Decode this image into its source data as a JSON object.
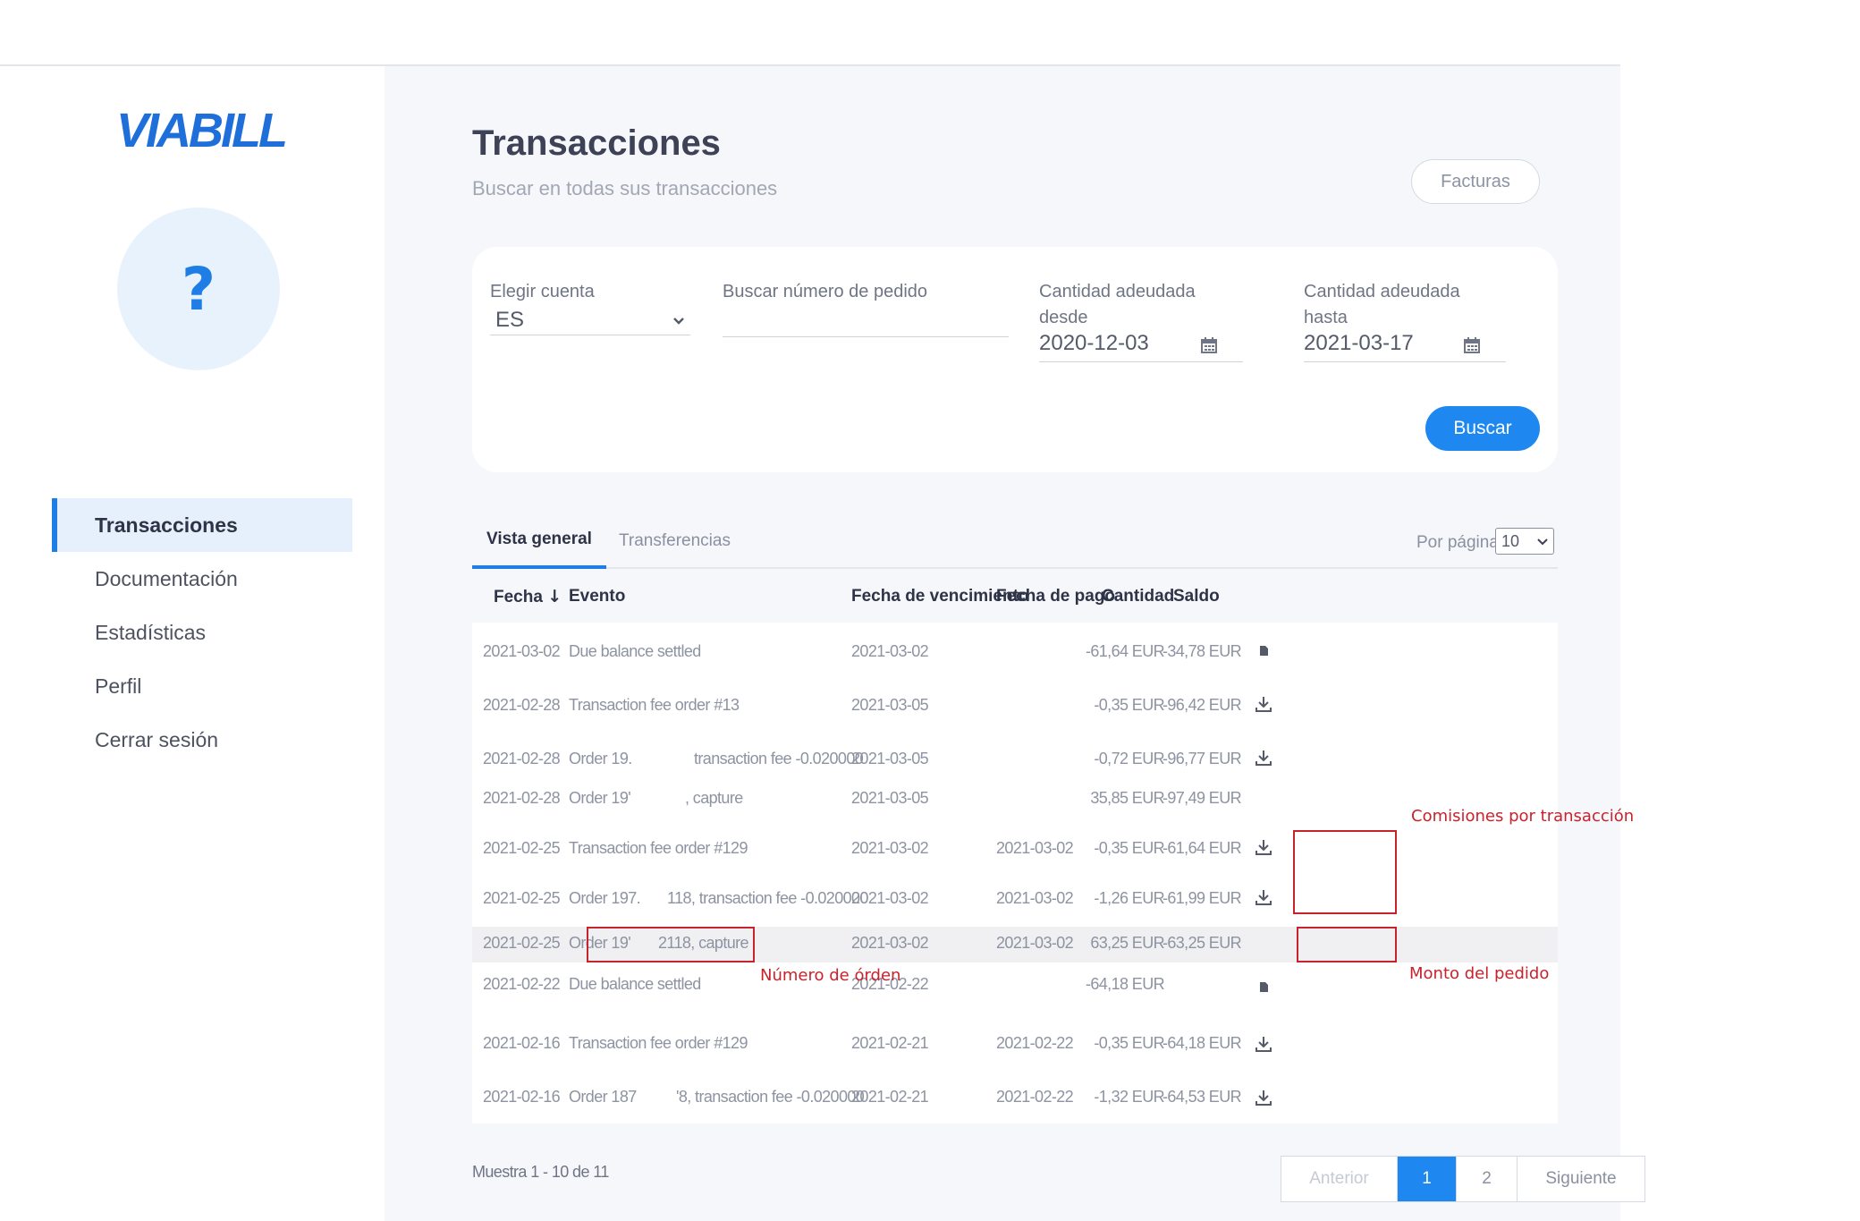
{
  "sidebar": {
    "logo_text": "VIABILL",
    "avatar_symbol": "?",
    "items": [
      {
        "label": "Transacciones",
        "active": true
      },
      {
        "label": "Documentación",
        "active": false
      },
      {
        "label": "Estadísticas",
        "active": false
      },
      {
        "label": "Perfil",
        "active": false
      },
      {
        "label": "Cerrar sesión",
        "active": false
      }
    ]
  },
  "header": {
    "title": "Transacciones",
    "subtitle": "Buscar en todas sus transacciones",
    "invoices_button": "Facturas"
  },
  "filters": {
    "account_label": "Elegir cuenta",
    "account_value": "ES",
    "order_label": "Buscar número de pedido",
    "order_value": "",
    "from_label_1": "Cantidad adeudada",
    "from_label_2": "desde",
    "from_value": "2020-12-03",
    "to_label_1": "Cantidad adeudada",
    "to_label_2": "hasta",
    "to_value": "2021-03-17",
    "search_button": "Buscar"
  },
  "tabs": {
    "overview": "Vista general",
    "transfers": "Transferencias",
    "per_page_label": "Por página",
    "per_page_value": "10"
  },
  "table": {
    "columns": {
      "date": "Fecha",
      "event": "Evento",
      "due_date": "Fecha de vencimiento",
      "pay_date": "Fecha de pago",
      "amount": "Cantidad",
      "balance": "Saldo"
    },
    "rows": [
      {
        "date": "2021-03-02",
        "event_a": "Due balance settled",
        "event_b": "",
        "due": "2021-03-02",
        "paid": "",
        "amount": "-61,64 EUR",
        "balance": "-34,78 EUR",
        "icon": "document-icon"
      },
      {
        "date": "2021-02-28",
        "event_a": "Transaction fee order #13",
        "event_b": "",
        "due": "2021-03-05",
        "paid": "",
        "amount": "-0,35 EUR",
        "balance": "-96,42 EUR",
        "icon": "download-icon"
      },
      {
        "date": "2021-02-28",
        "event_a": "Order 19.",
        "event_b": "transaction fee -0.020000",
        "due": "2021-03-05",
        "paid": "",
        "amount": "-0,72 EUR",
        "balance": "-96,77 EUR",
        "icon": "download-icon"
      },
      {
        "date": "2021-02-28",
        "event_a": "Order 19'",
        "event_b": ", capture",
        "due": "2021-03-05",
        "paid": "",
        "amount": "35,85 EUR",
        "balance": "-97,49 EUR",
        "icon": ""
      },
      {
        "date": "2021-02-25",
        "event_a": "Transaction fee order #129",
        "event_b": "",
        "due": "2021-03-02",
        "paid": "2021-03-02",
        "amount": "-0,35 EUR",
        "balance": "-61,64 EUR",
        "icon": "download-icon"
      },
      {
        "date": "2021-02-25",
        "event_a": "Order 197.",
        "event_b": "118, transaction fee -0.020000",
        "due": "2021-03-02",
        "paid": "2021-03-02",
        "amount": "-1,26 EUR",
        "balance": "-61,99 EUR",
        "icon": "download-icon"
      },
      {
        "date": "2021-02-25",
        "event_a": "Order 19'",
        "event_b": "2118, capture",
        "due": "2021-03-02",
        "paid": "2021-03-02",
        "amount": "63,25 EUR",
        "balance": "-63,25 EUR",
        "icon": ""
      },
      {
        "date": "2021-02-22",
        "event_a": "Due balance settled",
        "event_b": "",
        "due": "2021-02-22",
        "paid": "",
        "amount": "-64,18 EUR",
        "balance": "",
        "icon": "document-icon"
      },
      {
        "date": "2021-02-16",
        "event_a": "Transaction fee order #129",
        "event_b": "",
        "due": "2021-02-21",
        "paid": "2021-02-22",
        "amount": "-0,35 EUR",
        "balance": "-64,18 EUR",
        "icon": "download-icon"
      },
      {
        "date": "2021-02-16",
        "event_a": "Order 187",
        "event_b": "'8, transaction fee -0.020000",
        "due": "2021-02-21",
        "paid": "2021-02-22",
        "amount": "-1,32 EUR",
        "balance": "-64,53 EUR",
        "icon": "download-icon"
      }
    ]
  },
  "annotations": {
    "fees": "Comisiones por transacción",
    "order_number": "Número de órden",
    "order_amount": "Monto del pedido"
  },
  "footer": {
    "showing": "Muestra 1 - 10 de 11",
    "prev": "Anterior",
    "page1": "1",
    "page2": "2",
    "next": "Siguiente"
  },
  "colors": {
    "accent": "#1e88f0",
    "annotation": "#c8232c"
  }
}
